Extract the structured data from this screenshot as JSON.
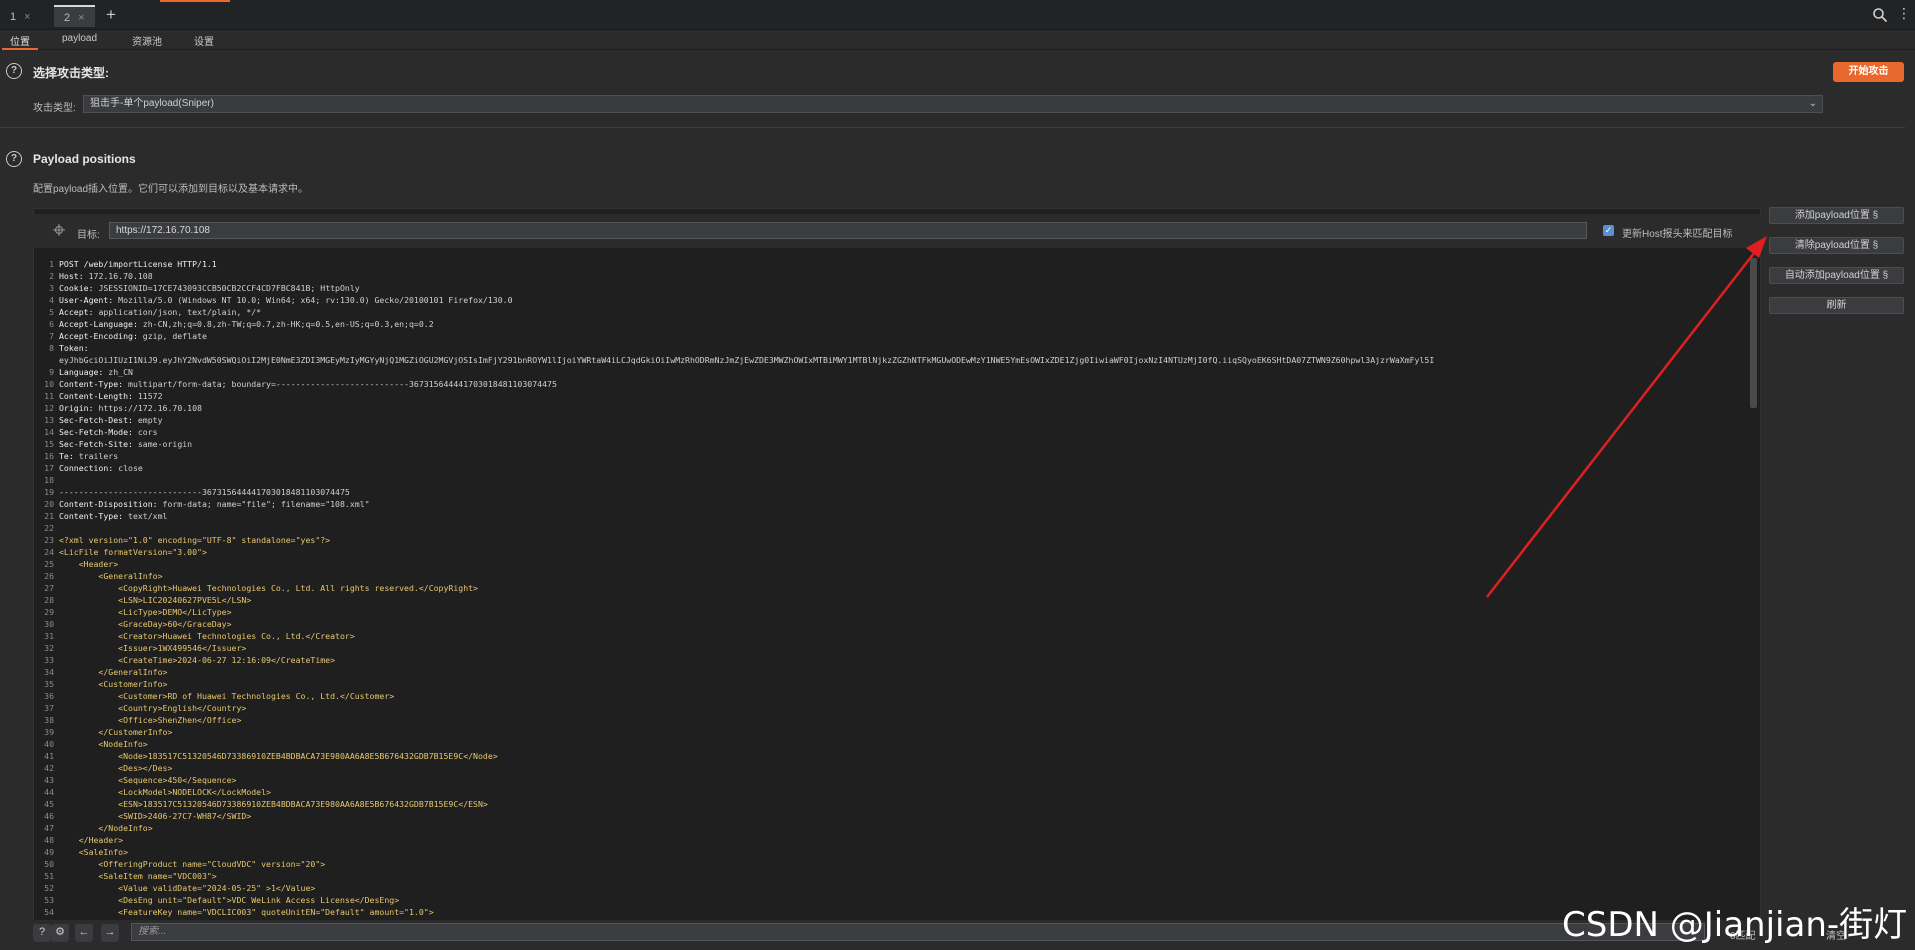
{
  "tabs": [
    {
      "label": "1",
      "close": "×"
    },
    {
      "label": "2",
      "close": "×"
    }
  ],
  "add_tab": "+",
  "subtabs": [
    "位置",
    "payload",
    "资源池",
    "设置"
  ],
  "attack": {
    "title": "选择攻击类型:",
    "start_button": "开始攻击",
    "type_label": "攻击类型:",
    "type_value": "狙击手-单个payload(Sniper)"
  },
  "positions": {
    "title": "Payload positions",
    "description": "配置payload插入位置。它们可以添加到目标以及基本请求中。",
    "target_label": "目标:",
    "target_value": "https://172.16.70.108",
    "update_host_label": "更新Host报头来匹配目标"
  },
  "side_buttons": [
    "添加payload位置 §",
    "清除payload位置 §",
    "自动添加payload位置 §",
    "刷新"
  ],
  "bottom": {
    "search_placeholder": "搜索...",
    "match_label": "0匹配",
    "clear_label": "清空"
  },
  "watermark": "CSDN @Jianjian-街灯",
  "accent_color": "#e8682f",
  "request_lines": [
    {
      "n": "1",
      "k": "POST /web/importLicense HTTP/1.1",
      "v": ""
    },
    {
      "n": "2",
      "k": "Host:",
      "v": " 172.16.70.108"
    },
    {
      "n": "3",
      "k": "Cookie:",
      "v": " JSESSIONID=17CE743093CCB50CB2CCF4CD7FBC841B; HttpOnly"
    },
    {
      "n": "4",
      "k": "User-Agent:",
      "v": " Mozilla/5.0 (Windows NT 10.0; Win64; x64; rv:130.0) Gecko/20100101 Firefox/130.0"
    },
    {
      "n": "5",
      "k": "Accept:",
      "v": " application/json, text/plain, */*"
    },
    {
      "n": "6",
      "k": "Accept-Language:",
      "v": " zh-CN,zh;q=0.8,zh-TW;q=0.7,zh-HK;q=0.5,en-US;q=0.3,en;q=0.2"
    },
    {
      "n": "7",
      "k": "Accept-Encoding:",
      "v": " gzip, deflate"
    },
    {
      "n": "8",
      "k": "Token:",
      "v": ""
    },
    {
      "n": "",
      "k": "",
      "v": "eyJhbGciOiJIUzI1NiJ9.eyJhY2NvdW50SWQiOiI2MjE0NmE3ZDI3MGEyMzIyMGYyNjQ1MGZiOGU2MGVjOSIsImFjY291bnROYW1lIjoiYWRtaW4iLCJqdGkiOiIwMzRhODRmNzJmZjEwZDE3MWZhOWIxMTBiMWY1MTBlNjkzZGZhNTFkMGUwODEwMzY1NWE5YmEsOWIxZDE1Zjg0IiwiaWF0IjoxNzI4NTUzMjI0fQ.iiqSQyoEK6SHtDA07ZTWN9Z60hpwl3AjzrWaXmFyl5I"
    },
    {
      "n": "9",
      "k": "Language:",
      "v": " zh_CN"
    },
    {
      "n": "10",
      "k": "Content-Type:",
      "v": " multipart/form-data; boundary=---------------------------367315644441703018481103074475"
    },
    {
      "n": "11",
      "k": "Content-Length:",
      "v": " 11572"
    },
    {
      "n": "12",
      "k": "Origin:",
      "v": " https://172.16.70.108"
    },
    {
      "n": "13",
      "k": "Sec-Fetch-Dest:",
      "v": " empty"
    },
    {
      "n": "14",
      "k": "Sec-Fetch-Mode:",
      "v": " cors"
    },
    {
      "n": "15",
      "k": "Sec-Fetch-Site:",
      "v": " same-origin"
    },
    {
      "n": "16",
      "k": "Te:",
      "v": " trailers"
    },
    {
      "n": "17",
      "k": "Connection:",
      "v": " close"
    },
    {
      "n": "18",
      "k": "",
      "v": ""
    },
    {
      "n": "19",
      "k": "",
      "v": "-----------------------------367315644441703018481103074475"
    },
    {
      "n": "20",
      "k": "Content-Disposition:",
      "v": " form-data; name=\"file\"; filename=\"108.xml\""
    },
    {
      "n": "21",
      "k": "Content-Type:",
      "v": " text/xml"
    },
    {
      "n": "22",
      "k": "",
      "v": ""
    },
    {
      "n": "23",
      "k": "",
      "x": "<?xml version=\"1.0\" encoding=\"UTF-8\" standalone=\"yes\"?>"
    },
    {
      "n": "24",
      "k": "",
      "x": "<LicFile formatVersion=\"3.00\">"
    },
    {
      "n": "25",
      "k": "",
      "x": "    <Header>"
    },
    {
      "n": "26",
      "k": "",
      "x": "        <GeneralInfo>"
    },
    {
      "n": "27",
      "k": "",
      "x": "            <CopyRight>Huawei Technologies Co., Ltd. All rights reserved.</CopyRight>"
    },
    {
      "n": "28",
      "k": "",
      "x": "            <LSN>LIC20240627PVE5L</LSN>"
    },
    {
      "n": "29",
      "k": "",
      "x": "            <LicType>DEMO</LicType>"
    },
    {
      "n": "30",
      "k": "",
      "x": "            <GraceDay>60</GraceDay>"
    },
    {
      "n": "31",
      "k": "",
      "x": "            <Creator>Huawei Technologies Co., Ltd.</Creator>"
    },
    {
      "n": "32",
      "k": "",
      "x": "            <Issuer>1WX499546</Issuer>"
    },
    {
      "n": "33",
      "k": "",
      "x": "            <CreateTime>2024-06-27 12:16:09</CreateTime>"
    },
    {
      "n": "34",
      "k": "",
      "x": "        </GeneralInfo>"
    },
    {
      "n": "35",
      "k": "",
      "x": "        <CustomerInfo>"
    },
    {
      "n": "36",
      "k": "",
      "x": "            <Customer>RD of Huawei Technologies Co., Ltd.</Customer>"
    },
    {
      "n": "37",
      "k": "",
      "x": "            <Country>English</Country>"
    },
    {
      "n": "38",
      "k": "",
      "x": "            <Office>ShenZhen</Office>"
    },
    {
      "n": "39",
      "k": "",
      "x": "        </CustomerInfo>"
    },
    {
      "n": "40",
      "k": "",
      "x": "        <NodeInfo>"
    },
    {
      "n": "41",
      "k": "",
      "x": "            <Node>183517C51320546D73386910ZEB4BDBACA73E980AA6A8E5B676432GDB7B15E9C</Node>"
    },
    {
      "n": "42",
      "k": "",
      "x": "            <Des></Des>"
    },
    {
      "n": "43",
      "k": "",
      "x": "            <Sequence>450</Sequence>"
    },
    {
      "n": "44",
      "k": "",
      "x": "            <LockModel>NODELOCK</LockModel>"
    },
    {
      "n": "45",
      "k": "",
      "x": "            <ESN>183517C51320546D73386910ZEB4BDBACA73E980AA6A8E5B676432GDB7B15E9C</ESN>"
    },
    {
      "n": "46",
      "k": "",
      "x": "            <SWID>2406-27C7-WH87</SWID>"
    },
    {
      "n": "47",
      "k": "",
      "x": "        </NodeInfo>"
    },
    {
      "n": "48",
      "k": "",
      "x": "    </Header>"
    },
    {
      "n": "49",
      "k": "",
      "x": "    <SaleInfo>"
    },
    {
      "n": "50",
      "k": "",
      "x": "        <OfferingProduct name=\"CloudVDC\" version=\"20\">"
    },
    {
      "n": "51",
      "k": "",
      "x": "        <SaleItem name=\"VDC003\">"
    },
    {
      "n": "52",
      "k": "",
      "x": "            <Value validDate=\"2024-05-25\" >1</Value>"
    },
    {
      "n": "53",
      "k": "",
      "x": "            <DesEng unit=\"Default\">VDC WeLink Access License</DesEng>"
    },
    {
      "n": "54",
      "k": "",
      "x": "            <FeatureKey name=\"VDCLIC003\" quoteUnitEN=\"Default\" amount=\"1.0\">"
    }
  ]
}
